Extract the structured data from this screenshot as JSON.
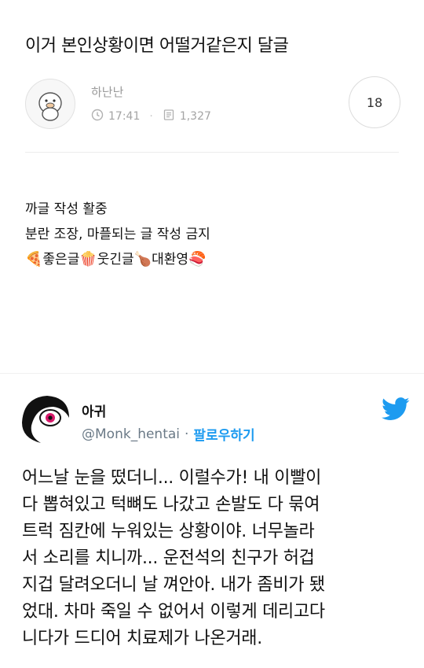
{
  "post": {
    "title": "이거 본인상황이면 어떨거같은지 달글",
    "author": "하난난",
    "time": "17:41",
    "views": "1,327",
    "comment_count": "18"
  },
  "body": {
    "lines": [
      "까글 작성 활중",
      "분란 조장, 마플되는 글 작성 금지"
    ],
    "emoji_line": {
      "e1": "🍕",
      "t1": "좋은글",
      "e2": "🍿",
      "t2": "웃긴글",
      "e3": "🍗",
      "t3": "대환영",
      "e4": "🍣"
    }
  },
  "tweet": {
    "name": "아귀",
    "handle": "@Monk_hentai",
    "separator": "·",
    "follow": "팔로우하기",
    "text_lines": [
      "어느날 눈을 떴더니... 이럴수가! 내 이빨이",
      "다 뽑혀있고 턱뼈도 나갔고 손발도 다 묶여",
      "트럭 짐칸에 누워있는 상황이야. 너무놀라",
      "서 소리를 치니까... 운전석의 친구가 허겁",
      "지겁 달려오더니 날 껴안아. 내가 좀비가 됐",
      "었대. 차마 죽일 수 없어서 이렇게 데리고다",
      "니다가 드디어 치료제가 나온거래."
    ],
    "brand_color": "#1d9bf0"
  },
  "icons": {
    "avatar": "cartoon-duck-avatar",
    "clock": "clock-icon",
    "views": "document-icon",
    "bird": "twitter-bird-icon",
    "tweet_avatar": "eye-avatar"
  }
}
